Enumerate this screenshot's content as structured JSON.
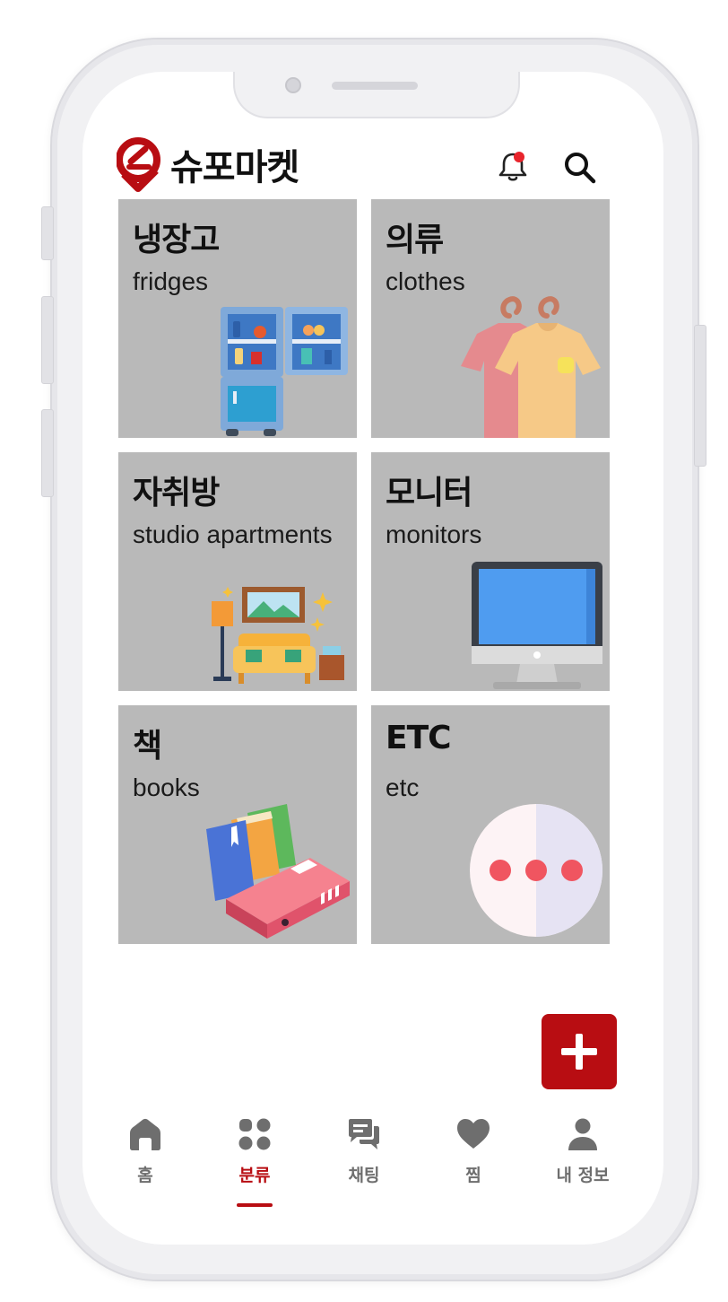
{
  "app": {
    "name": "슈포마켓",
    "accent_color": "#b80d12"
  },
  "header": {
    "notification_icon": "bell-icon",
    "search_icon": "search-icon"
  },
  "categories": [
    {
      "ko": "냉장고",
      "en": "fridges",
      "icon": "fridge-illustration"
    },
    {
      "ko": "의류",
      "en": "clothes",
      "icon": "clothes-illustration"
    },
    {
      "ko": "자취방",
      "en": "studio apartments",
      "icon": "room-illustration"
    },
    {
      "ko": "모니터",
      "en": "monitors",
      "icon": "monitor-illustration"
    },
    {
      "ko": "책",
      "en": "books",
      "icon": "books-illustration"
    },
    {
      "ko": "ETC",
      "en": "etc",
      "icon": "more-illustration"
    }
  ],
  "fab": {
    "icon": "plus-icon"
  },
  "nav": {
    "active": "분류",
    "items": [
      {
        "label": "홈",
        "icon": "home-icon"
      },
      {
        "label": "분류",
        "icon": "category-icon"
      },
      {
        "label": "채팅",
        "icon": "chat-icon"
      },
      {
        "label": "찜",
        "icon": "heart-icon"
      },
      {
        "label": "내 정보",
        "icon": "user-icon"
      }
    ]
  }
}
